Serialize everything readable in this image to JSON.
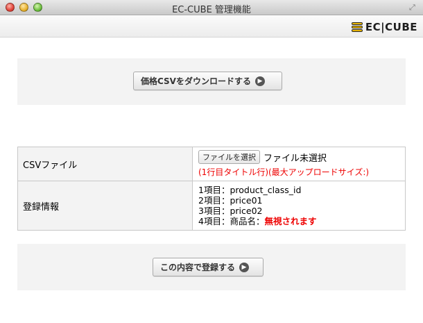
{
  "window": {
    "title": "EC-CUBE 管理機能"
  },
  "header": {
    "logo_text": "EC|CUBE"
  },
  "download": {
    "button_label": "価格CSVをダウンロードする"
  },
  "form": {
    "rows": [
      {
        "label": "CSVファイル",
        "file_button": "ファイルを選択",
        "file_status": "ファイル未選択",
        "note": "(1行目タイトル行)(最大アップロードサイズ:)"
      },
      {
        "label": "登録情報",
        "items": [
          "1項目：product_class_id",
          "2項目：price01",
          "3項目：price02",
          "4項目：商品名："
        ],
        "ignore_text": "無視されます"
      }
    ]
  },
  "submit": {
    "button_label": "この内容で登録する"
  },
  "colors": {
    "warning": "#ee0000",
    "panel": "#f3f3f3"
  }
}
